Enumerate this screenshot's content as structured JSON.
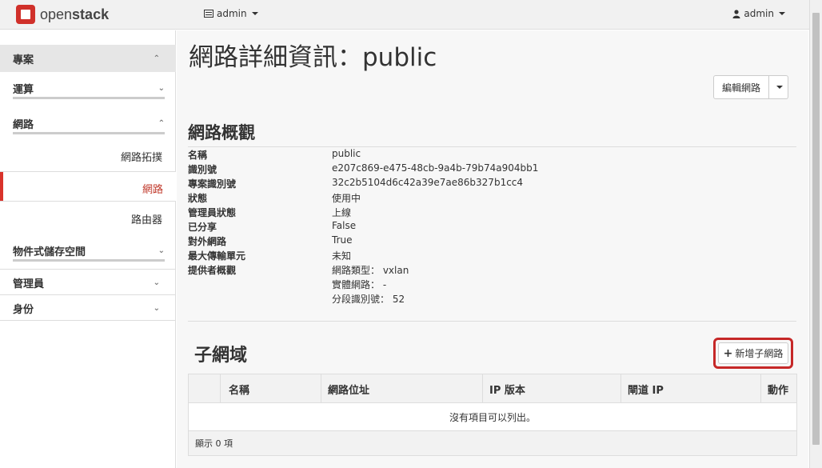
{
  "navbar": {
    "logo_prefix": "open",
    "logo_suffix": "stack",
    "project_label": "admin",
    "user_label": "admin"
  },
  "sidebar": {
    "panels": [
      {
        "label": "專案",
        "chevron": "^"
      },
      {
        "label": "運算",
        "chevron": "v"
      },
      {
        "label": "網路",
        "chevron": "^"
      },
      {
        "label": "物件式儲存空間",
        "chevron": "v"
      },
      {
        "label": "管理員",
        "chevron": "v"
      },
      {
        "label": "身份",
        "chevron": "v"
      }
    ],
    "links": [
      {
        "label": "網路拓撲"
      },
      {
        "label": "網路"
      },
      {
        "label": "路由器"
      }
    ]
  },
  "main": {
    "title": "網路詳細資訊：public",
    "edit_button": "編輯網路",
    "overview_title": "網路概觀",
    "details": [
      {
        "key": "名稱",
        "value": "public"
      },
      {
        "key": "識別號",
        "value": "e207c869-e475-48cb-9a4b-79b74a904bb1"
      },
      {
        "key": "專案識別號",
        "value": "32c2b5104d6c42a39e7ae86b327b1cc4"
      },
      {
        "key": "狀態",
        "value": "使用中"
      },
      {
        "key": "管理員狀態",
        "value": "上線"
      },
      {
        "key": "已分享",
        "value": "False"
      },
      {
        "key": "對外網路",
        "value": "True"
      },
      {
        "key": "最大傳輸單元",
        "value": "未知"
      },
      {
        "key": "提供者概觀",
        "value": "網路類型： vxlan"
      }
    ],
    "provider_extra": [
      "實體網路： -",
      "分段識別號： 52"
    ],
    "subnets_title": "子網域",
    "add_subnet_button": "新增子網路",
    "table": {
      "headers": [
        "名稱",
        "網路位址",
        "IP 版本",
        "閘道 IP",
        "動作"
      ],
      "empty_message": "沒有項目可以列出。",
      "footer": "顯示 0 項"
    }
  }
}
